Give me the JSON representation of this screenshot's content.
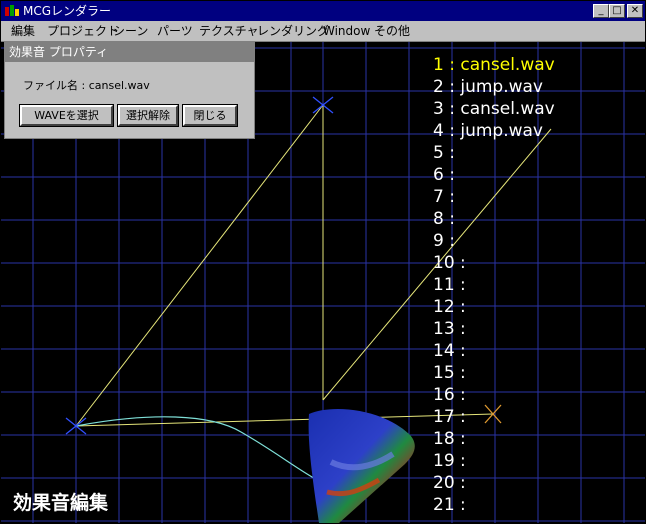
{
  "window": {
    "title": "MCGレンダラー",
    "minimize_glyph": "_",
    "maximize_glyph": "□",
    "close_glyph": "✕"
  },
  "menu": [
    "編集",
    "プロジェクト",
    "シーン",
    "パーツ",
    "テクスチャ",
    "レンダリング",
    "Window",
    "その他"
  ],
  "panel": {
    "title": "効果音 プロパティ",
    "file_label": "ファイル名 : cansel.wav",
    "buttons": {
      "select_wave": "WAVEを選択",
      "deselect": "選択解除",
      "close": "閉じる"
    }
  },
  "sound_list": [
    "1 : cansel.wav",
    "2 : jump.wav",
    "3 : cansel.wav",
    "4 : jump.wav",
    "5 :",
    "6 :",
    "7 :",
    "8 :",
    "9 :",
    "10 :",
    "11 :",
    "12 :",
    "13 :",
    "14 :",
    "15 :",
    "16 :",
    "17 :",
    "18 :",
    "19 :",
    "20 :",
    "21 :"
  ],
  "selected_index": 0,
  "mode_label": "効果音編集",
  "colors": {
    "title_active": "#000080",
    "panel_title": "#808080",
    "grid": "#2a33a6",
    "guide_line": "#e6e67a",
    "curve": "#7fe0d8",
    "highlight_text": "#ffff00"
  }
}
